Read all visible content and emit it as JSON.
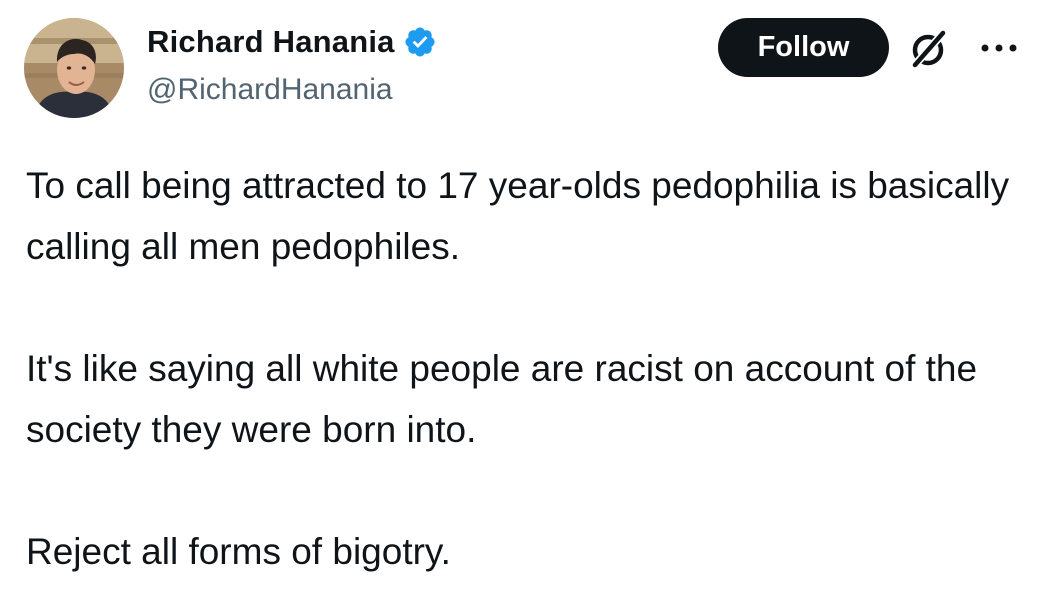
{
  "author": {
    "display_name": "Richard Hanania",
    "handle": "@RichardHanania",
    "verified": true,
    "verified_color": "#1d9bf0"
  },
  "actions": {
    "follow_label": "Follow",
    "grok_icon": "grok-icon",
    "more_icon": "more-horizontal-icon"
  },
  "tweet": {
    "paragraphs": [
      "To call being attracted to 17 year-olds pedophilia is basically calling all men pedophiles.",
      "It's like saying all white people are racist on account of the society they were born into.",
      "Reject all forms of bigotry."
    ]
  },
  "colors": {
    "text": "#0f1419",
    "secondary_text": "#536471",
    "button_bg": "#0f1419",
    "button_text": "#ffffff"
  }
}
